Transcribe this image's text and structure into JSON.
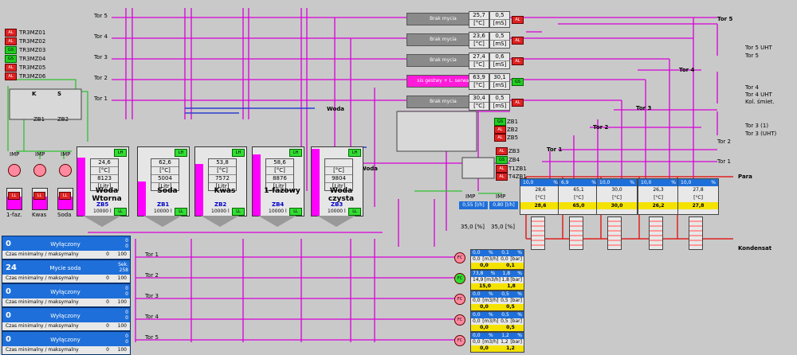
{
  "colors": {
    "pipe": "#d800d8",
    "water": "#2b3fd0",
    "steam": "#e02020",
    "air": "#30c030",
    "background": "#c9c9c9",
    "panel": "#1e6fd9",
    "value": "#f4e200"
  },
  "legend": [
    {
      "state": "AL",
      "code": "TR3MZ01"
    },
    {
      "state": "AL",
      "code": "TR3MZ02"
    },
    {
      "state": "GS",
      "code": "TR3MZ03"
    },
    {
      "state": "GS",
      "code": "TR3MZ04"
    },
    {
      "state": "AL",
      "code": "TR3MZ05"
    },
    {
      "state": "AL",
      "code": "TR3MZ06"
    }
  ],
  "tor_left": [
    "Tor 5",
    "Tor 4",
    "Tor 3",
    "Tor 2",
    "Tor 1"
  ],
  "woda_label": "Woda",
  "dosing": {
    "imp": "IMP",
    "ll": "LL",
    "names": [
      "1-faz.",
      "Kwas",
      "Soda"
    ]
  },
  "zb": [
    "ZB1",
    "ZB2"
  ],
  "valve_ks": [
    "K",
    "S"
  ],
  "tanks": [
    {
      "name": "Woda Wtorna",
      "id": "ZB5",
      "temp": "24,6",
      "level": "8123",
      "cap": "10000 l",
      "lh": "LH",
      "ll": "LL",
      "fill": 0.85
    },
    {
      "name": "Soda",
      "id": "ZB1",
      "temp": "62,6",
      "level": "5004",
      "cap": "10000 l",
      "lh": "LH",
      "ll": "LL",
      "fill": 0.5
    },
    {
      "name": "Kwas",
      "id": "ZB2",
      "temp": "53,8",
      "level": "7572",
      "cap": "10000 l",
      "lh": "LH",
      "ll": "LL",
      "fill": 0.76
    },
    {
      "name": "1-fazowy",
      "id": "ZB4",
      "temp": "58,6",
      "level": "8876",
      "cap": "10000 l",
      "lh": "LH",
      "ll": "LL",
      "fill": 0.89
    },
    {
      "name": "Woda czysta",
      "id": "ZB3",
      "temp": "",
      "level": "9804",
      "cap": "10000 l",
      "lh": "LH",
      "ll": "LL",
      "fill": 0.98
    }
  ],
  "units": {
    "temp": "[°C]",
    "litr": "[Litr]",
    "ms": "[mS]",
    "m3h": "[m3/h]",
    "bar": "[bar]",
    "pct": "%"
  },
  "wash": [
    {
      "label": "Brak mycia",
      "temp": "25,7",
      "cond": "0,5",
      "active": false
    },
    {
      "label": "Brak mycia",
      "temp": "23,6",
      "cond": "0,5",
      "active": false
    },
    {
      "label": "Brak mycia",
      "temp": "27,4",
      "cond": "0,6",
      "active": false
    },
    {
      "label": "sis gestwy + L. serwa",
      "temp": "63,9",
      "cond": "30,1",
      "active": true
    },
    {
      "label": "Brak mycia",
      "temp": "30,4",
      "cond": "0,5",
      "active": false
    }
  ],
  "right_status": [
    {
      "state": "GS",
      "code": "ZB1"
    },
    {
      "state": "AL",
      "code": "ZB2"
    },
    {
      "state": "AL",
      "code": "ZB5"
    },
    {
      "state": "AL",
      "code": "ZB3"
    },
    {
      "state": "GS",
      "code": "ZB4"
    },
    {
      "state": "AL",
      "code": "T1ZB1"
    },
    {
      "state": "AL",
      "code": "T4ZB1"
    }
  ],
  "tor_right": {
    "t5": "Tor 5",
    "t5uht": "Tor 5 UHT",
    "t5b": "Tor 5",
    "t4": "Tor 4",
    "t4b": "Tor 4",
    "t4uht": "Tor 4 UHT",
    "kol": "Kol. śmiet.",
    "t3": "Tor 3",
    "t3a": "Tor 3 (1)",
    "t3uht": "Tor 3 (UHT)",
    "t2": "Tor 2",
    "t2b": "Tor 2",
    "t1": "Tor 1",
    "t1b": "Tor 1",
    "para": "Para",
    "kondensat": "Kondensat"
  },
  "hx": [
    {
      "pct": "10,0",
      "t": "28,6",
      "v": "28,6"
    },
    {
      "pct": "6,9",
      "t": "65,1",
      "v": "65,0"
    },
    {
      "pct": "10,0",
      "t": "30,0",
      "v": "30,0"
    },
    {
      "pct": "10,0",
      "t": "26,3",
      "v": "26,2"
    },
    {
      "pct": "10,0",
      "t": "27,8",
      "v": "27,8"
    }
  ],
  "imp_meters": [
    {
      "label": "IMP",
      "value": "0,55",
      "unit": "[l/h]"
    },
    {
      "label": "IMP",
      "value": "0,80",
      "unit": "[l/h]"
    }
  ],
  "pct_bottom": [
    {
      "v": "35,0",
      "u": "[%]"
    },
    {
      "v": "35,0",
      "u": "[%]"
    }
  ],
  "panels": [
    {
      "num": "0",
      "text": "Wyłączony",
      "side1": "0",
      "side2": "0",
      "sub": "Czas minimalny / maksymalny",
      "min": "0",
      "max": "100"
    },
    {
      "num": "24",
      "text": "Mycie soda",
      "side1": "Sek.",
      "side2": "258",
      "sub": "Czas minimalny / maksymalny",
      "min": "0",
      "max": "100"
    },
    {
      "num": "0",
      "text": "Wyłączony",
      "side1": "0",
      "side2": "0",
      "sub": "Czas minimalny / maksymalny",
      "min": "0",
      "max": "100"
    },
    {
      "num": "0",
      "text": "Wyłączony",
      "side1": "0",
      "side2": "0",
      "sub": "Czas minimalny / maksymalny",
      "min": "0",
      "max": "100"
    },
    {
      "num": "0",
      "text": "Wyłączony",
      "side1": "0",
      "side2": "0",
      "sub": "Czas minimalny / maksymalny",
      "min": "0",
      "max": "100"
    }
  ],
  "tor_bottom": [
    "Tor 1",
    "Tor 2",
    "Tor 3",
    "Tor 4",
    "Tor 5"
  ],
  "flows": [
    {
      "p1": "0,0",
      "p2": "0,1",
      "f": "0,0",
      "b": "0,0",
      "y1": "0,0",
      "y2": "0,1"
    },
    {
      "p1": "73,8",
      "p2": "1,8",
      "f": "14,9",
      "b": "1,8",
      "y1": "15,0",
      "y2": "1,8"
    },
    {
      "p1": "0,0",
      "p2": "0,5",
      "f": "0,0",
      "b": "0,5",
      "y1": "0,0",
      "y2": "0,5"
    },
    {
      "p1": "0,0",
      "p2": "0,5",
      "f": "0,0",
      "b": "0,5",
      "y1": "0,0",
      "y2": "0,5"
    },
    {
      "p1": "0,0",
      "p2": "1,2",
      "f": "0,0",
      "b": "1,2",
      "y1": "0,0",
      "y2": "1,2"
    }
  ],
  "fc_label": "FC",
  "ll_label": "LL"
}
